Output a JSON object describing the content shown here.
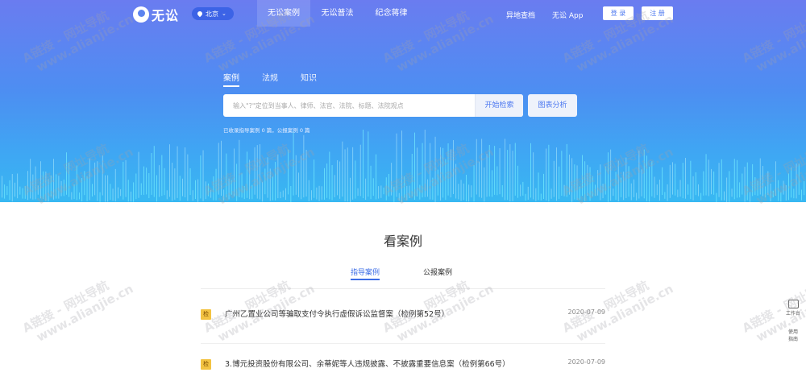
{
  "nav": {
    "logo_text": "无讼",
    "city": "北京",
    "tabs": [
      "无讼案例",
      "无讼普法",
      "纪念蒋律"
    ],
    "links": [
      "异地查档",
      "无讼 App"
    ],
    "login": "登 录",
    "register": "注 册"
  },
  "search": {
    "tabs": [
      "案例",
      "法规",
      "知识"
    ],
    "placeholder": "输入\"?\"定位到当事人、律师、法官、法院、标题、法院观点",
    "search_button": "开始检索",
    "chart_button": "图表分析",
    "stats": "已收录指导案例 0 篇，公报案例 0 篇"
  },
  "main": {
    "title": "看案例",
    "tabs": [
      "指导案例",
      "公报案例"
    ],
    "cases": [
      {
        "badge": "检",
        "title": "广州乙置业公司等骗取支付令执行虚假诉讼监督案（检例第52号）",
        "date": "2020-07-09"
      },
      {
        "badge": "检",
        "title": "3.博元投资股份有限公司、余蒂妮等人违规披露、不披露重要信息案（检例第66号）",
        "date": "2020-07-09"
      }
    ]
  },
  "side": {
    "label": "使用\n指南",
    "label_top": "工作台"
  },
  "watermark": {
    "line1": "A链接 - 网址导航",
    "line2": "www.alianjie.cn"
  },
  "colors": {
    "accent": "#3b6ce6",
    "hero_top": "#6a7cf0",
    "hero_bottom": "#38b8f2",
    "badge": "#f3c342"
  }
}
